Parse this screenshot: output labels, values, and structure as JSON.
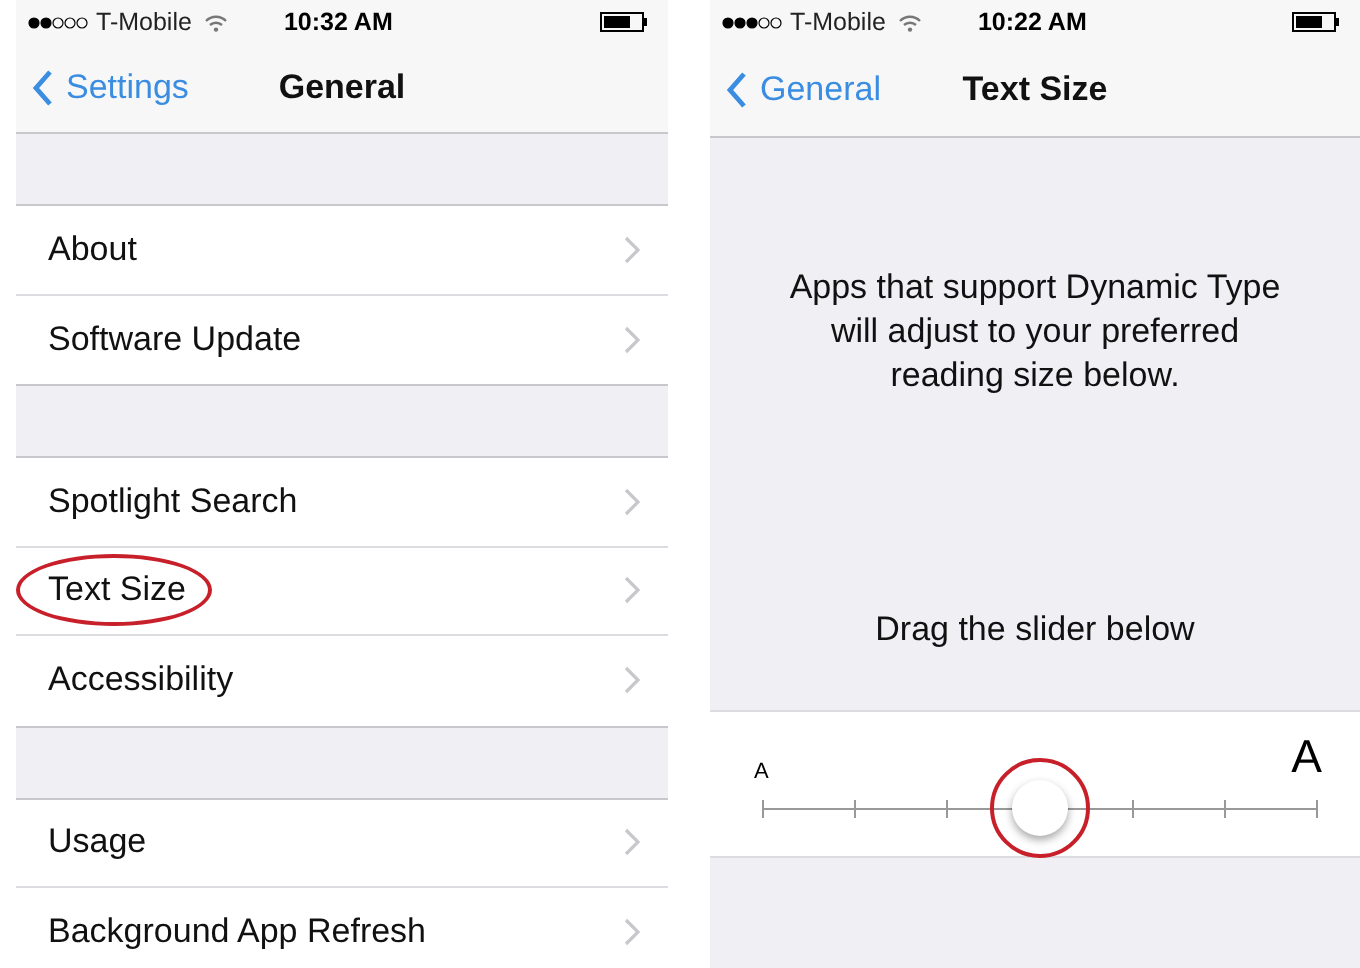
{
  "left_phone": {
    "status_bar": {
      "carrier": "T-Mobile",
      "time": "10:32 AM"
    },
    "nav": {
      "back": "Settings",
      "title": "General"
    },
    "groups": [
      [
        {
          "label": "About",
          "circled": false
        },
        {
          "label": "Software Update",
          "circled": false
        }
      ],
      [
        {
          "label": "Spotlight Search",
          "circled": false
        },
        {
          "label": "Text Size",
          "circled": true
        },
        {
          "label": "Accessibility",
          "circled": false
        }
      ],
      [
        {
          "label": "Usage",
          "circled": false
        },
        {
          "label": "Background App Refresh",
          "circled": false
        }
      ]
    ]
  },
  "right_phone": {
    "status_bar": {
      "carrier": "T-Mobile",
      "time": "10:22 AM"
    },
    "nav": {
      "back": "General",
      "title": "Text Size"
    },
    "description": "Apps that support Dynamic Type will adjust to your preferred reading size below.",
    "hint": "Drag the slider below",
    "slider": {
      "small_label": "A",
      "large_label": "A",
      "level": 0.5,
      "circled": true
    }
  }
}
